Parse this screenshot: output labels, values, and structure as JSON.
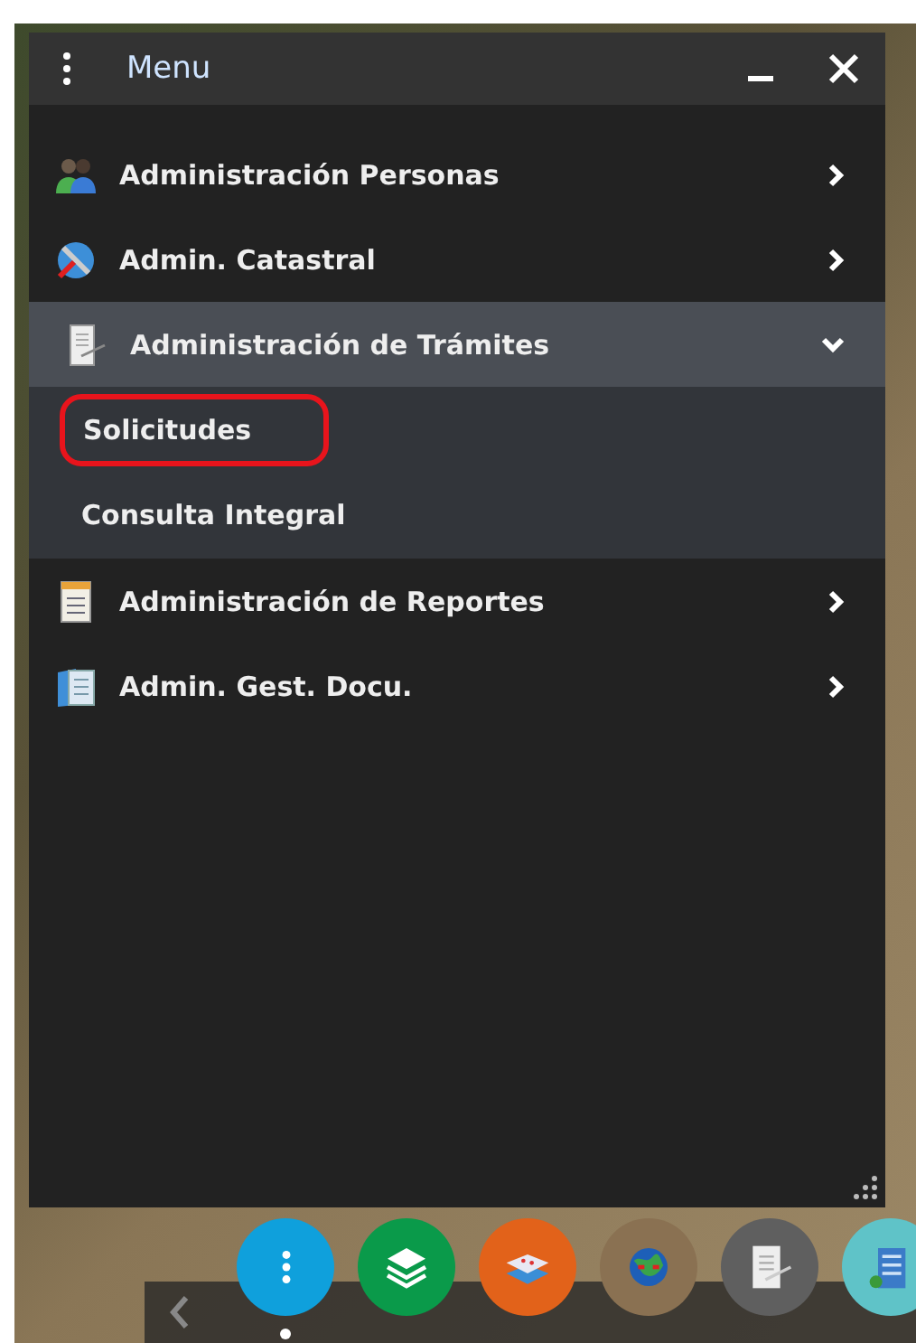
{
  "window": {
    "title": "Menu"
  },
  "menu_items": [
    {
      "label": "Administración Personas",
      "expanded": false
    },
    {
      "label": "Admin. Catastral",
      "expanded": false
    },
    {
      "label": "Administración de Trámites",
      "expanded": true,
      "children": [
        {
          "label": "Solicitudes",
          "circled": true
        },
        {
          "label": "Consulta Integral",
          "circled": false
        }
      ]
    },
    {
      "label": "Administración de Reportes",
      "expanded": false
    },
    {
      "label": "Admin. Gest. Docu.",
      "expanded": false
    }
  ],
  "dock": [
    {
      "kind": "dots",
      "color": "#0fa0dc",
      "selected": true
    },
    {
      "kind": "layers",
      "color": "#0a9a4a",
      "selected": false
    },
    {
      "kind": "map",
      "color": "#e2621a",
      "selected": false
    },
    {
      "kind": "globe",
      "color": "#8a7152",
      "selected": false
    },
    {
      "kind": "document",
      "color": "#5f5f5f",
      "selected": false
    },
    {
      "kind": "building",
      "color": "#5fc3c8",
      "selected": false
    }
  ]
}
